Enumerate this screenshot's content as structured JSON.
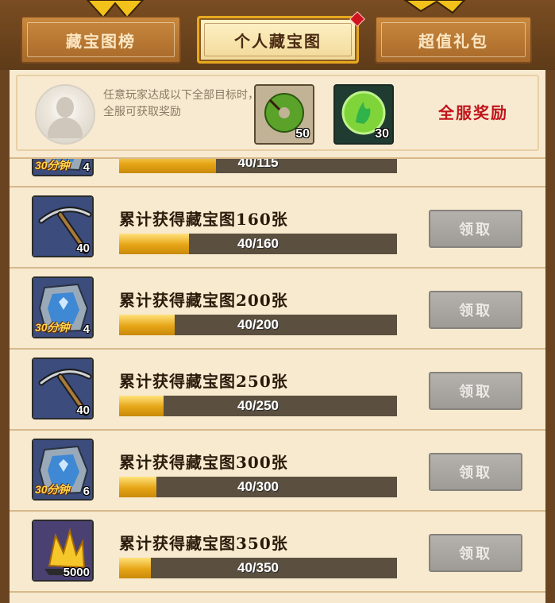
{
  "tabs": [
    {
      "label": "藏宝图榜",
      "active": false
    },
    {
      "label": "个人藏宝图",
      "active": true
    },
    {
      "label": "超值礼包",
      "active": false
    }
  ],
  "header": {
    "description": "任意玩家达成以下全部目标时，全服可获取奖励",
    "rewards": [
      {
        "icon": "jade-disc-icon",
        "count": "50"
      },
      {
        "icon": "green-flame-orb-icon",
        "count": "30"
      }
    ],
    "global_reward_label": "全服奖励"
  },
  "rows": [
    {
      "title": "",
      "progress_text": "40/115",
      "progress": 0.348,
      "icon": "map-stone-icon",
      "badge": "30分钟",
      "count": "4",
      "button": ""
    },
    {
      "title": "累计获得藏宝图160张",
      "progress_text": "40/160",
      "progress": 0.25,
      "icon": "pickaxe-icon",
      "badge": "",
      "count": "40",
      "button": "领取"
    },
    {
      "title": "累计获得藏宝图200张",
      "progress_text": "40/200",
      "progress": 0.2,
      "icon": "map-stone-icon",
      "badge": "30分钟",
      "count": "4",
      "button": "领取"
    },
    {
      "title": "累计获得藏宝图250张",
      "progress_text": "40/250",
      "progress": 0.16,
      "icon": "pickaxe-icon",
      "badge": "",
      "count": "40",
      "button": "领取"
    },
    {
      "title": "累计获得藏宝图300张",
      "progress_text": "40/300",
      "progress": 0.133,
      "icon": "map-stone-icon",
      "badge": "30分钟",
      "count": "6",
      "button": "领取"
    },
    {
      "title": "累计获得藏宝图350张",
      "progress_text": "40/350",
      "progress": 0.114,
      "icon": "gold-crystal-icon",
      "badge": "",
      "count": "5000",
      "button": "领取"
    }
  ],
  "colors": {
    "accent_red": "#c0141a",
    "progress_gold": "#e6a516",
    "button_disabled": "#a8a5a0"
  }
}
